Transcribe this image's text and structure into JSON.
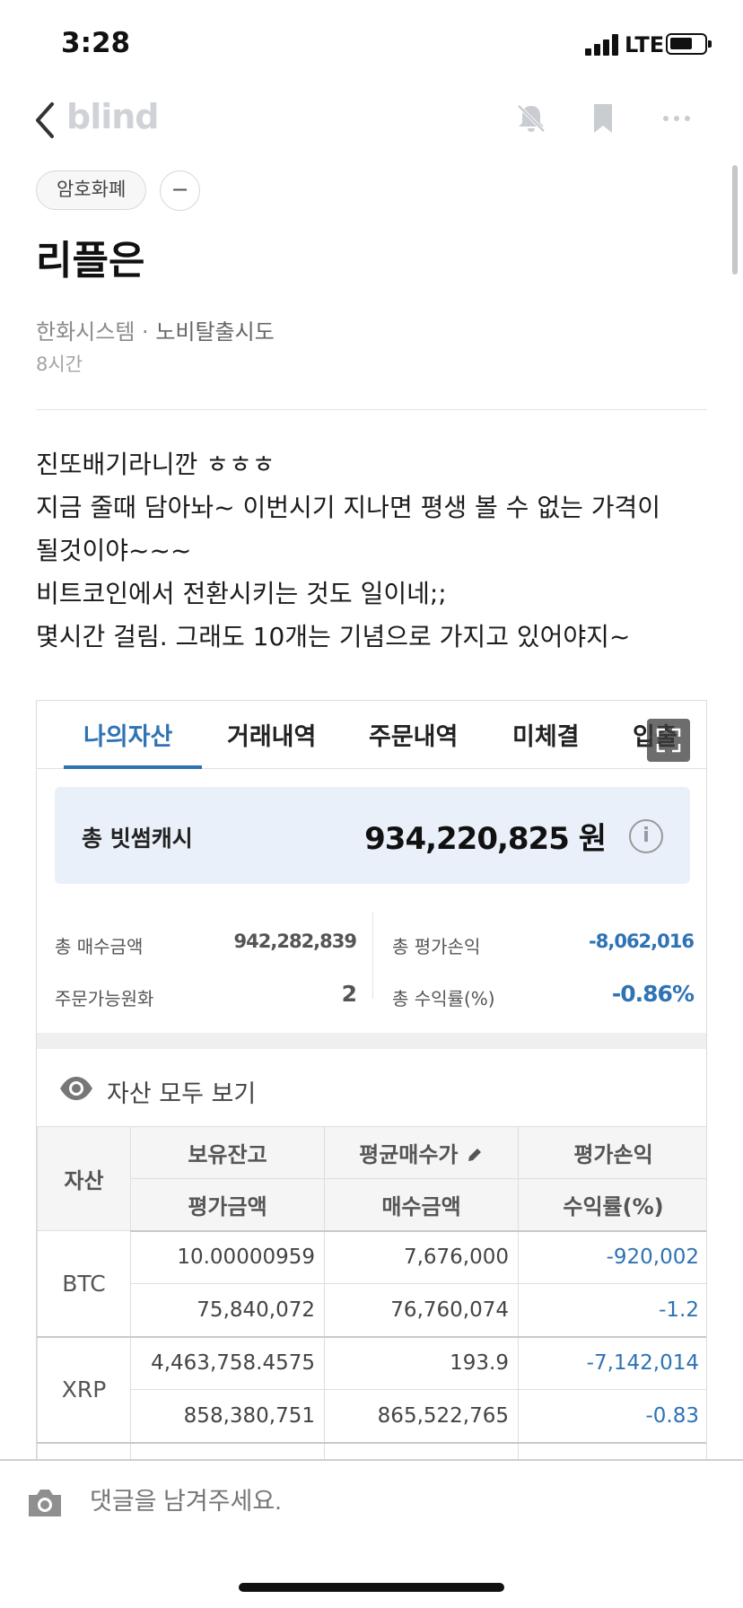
{
  "status_bar": {
    "time": "3:28",
    "network": "LTE"
  },
  "nav": {
    "logo": "blind"
  },
  "post": {
    "tag": "암호화폐",
    "tag_action": "−",
    "title": "리플은",
    "company": "한화시스템",
    "author": "노비탈출시도",
    "time": "8시간",
    "body_lines": [
      "진또배기라니깐 ㅎㅎㅎ",
      "지금 줄때 담아놔~ 이번시기 지나면 평생 볼 수 없는 가격이",
      "될것이야~~~",
      "비트코인에서 전환시키는 것도 일이네;;",
      "몇시간 걸림. 그래도 10개는 기념으로 가지고 있어야지~"
    ]
  },
  "embedded": {
    "tabs": [
      "나의자산",
      "거래내역",
      "주문내역",
      "미체결",
      "입출"
    ],
    "active_tab": "나의자산",
    "total": {
      "label": "총 빗썸캐시",
      "value": "934,220,825 원"
    },
    "summary": {
      "buy_total_label": "총 매수금액",
      "buy_total": "942,282,839",
      "orderable_label": "주문가능원화",
      "orderable": "2",
      "eval_pl_label": "총 평가손익",
      "eval_pl": "-8,062,016",
      "return_label": "총 수익률(%)",
      "return": "-0.86%"
    },
    "view_all": "자산 모두 보기",
    "table": {
      "head_asset": "자산",
      "head_row1": [
        "보유잔고",
        "평균매수가",
        "평가손익"
      ],
      "head_row2": [
        "평가금액",
        "매수금액",
        "수익률(%)"
      ],
      "rows": [
        {
          "asset": "BTC",
          "line1": [
            "10.00000959",
            "7,676,000",
            "-920,002"
          ],
          "line2": [
            "75,840,072",
            "76,760,074",
            "-1.2"
          ]
        },
        {
          "asset": "XRP",
          "line1": [
            "4,463,758.4575",
            "193.9",
            "-7,142,014"
          ],
          "line2": [
            "858,380,751",
            "865,522,765",
            "-0.83"
          ]
        }
      ]
    }
  },
  "comment": {
    "placeholder": "댓글을 남겨주세요."
  },
  "colors": {
    "accent": "#2f73b5",
    "total_bg": "#e9f0f9",
    "logo": "#cfd3d8"
  },
  "icons": [
    "back-icon",
    "bell-off-icon",
    "bookmark-icon",
    "more-icon",
    "info-icon",
    "eye-icon",
    "pencil-icon",
    "camera-icon",
    "expand-icon"
  ]
}
